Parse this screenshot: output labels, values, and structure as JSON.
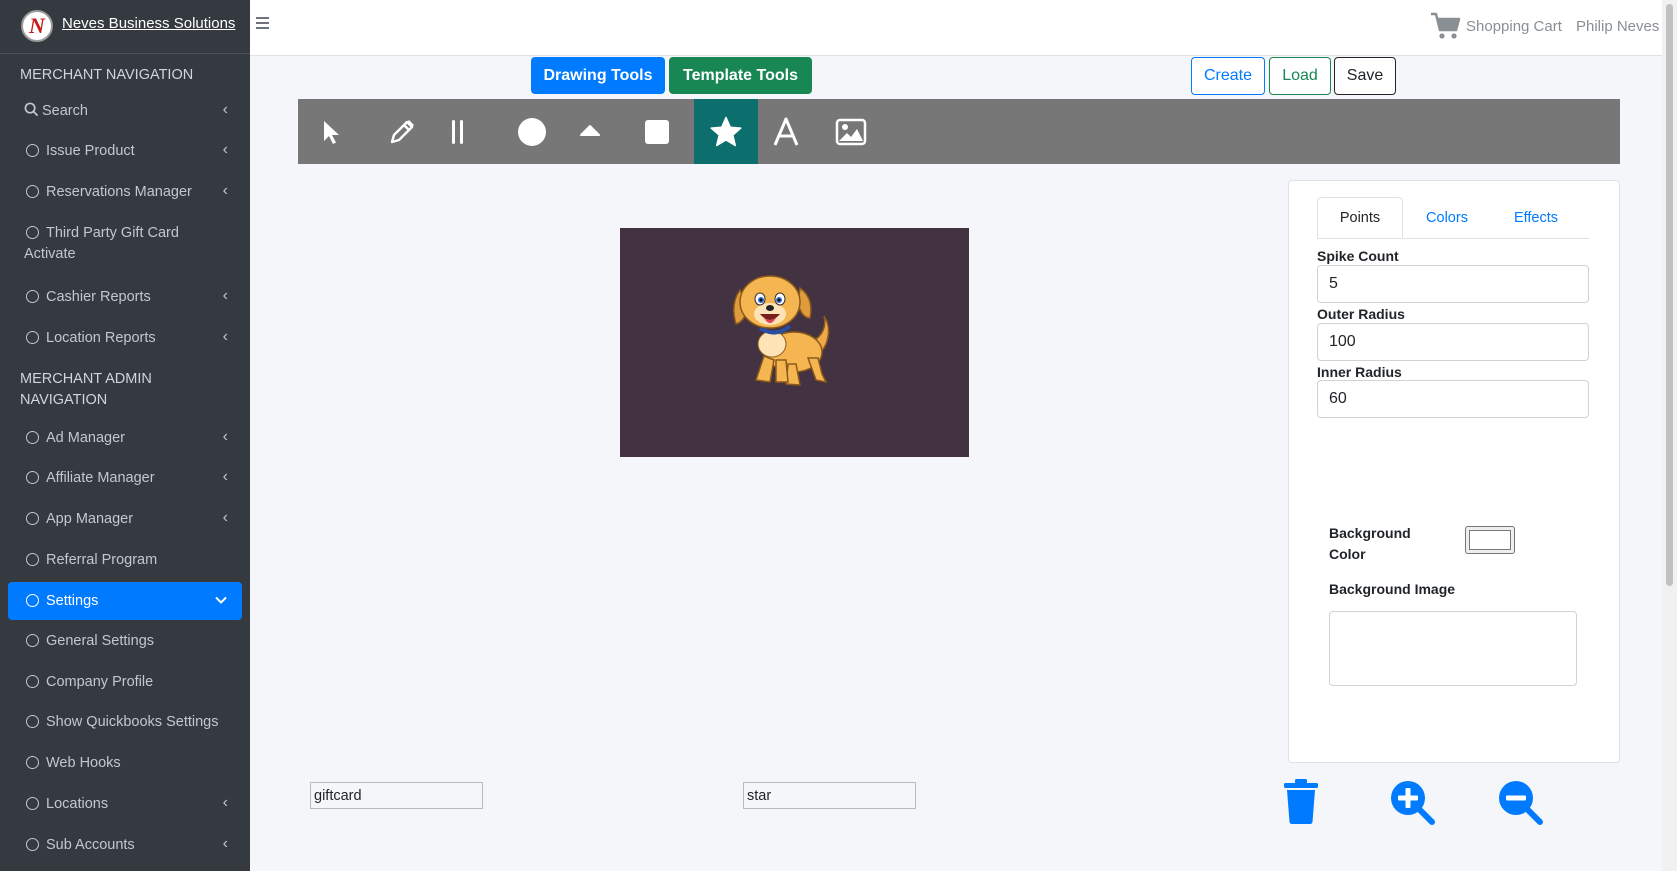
{
  "brand": {
    "logo_letter": "N",
    "name": "Neves Business Solutions"
  },
  "sidebar": {
    "header1": "MERCHANT NAVIGATION",
    "header2": "MERCHANT ADMIN NAVIGATION",
    "items": [
      {
        "label": "Search"
      },
      {
        "label": "Issue Product"
      },
      {
        "label": "Reservations Manager"
      },
      {
        "label": "Third Party Gift Card Activate"
      },
      {
        "label": "Cashier Reports"
      },
      {
        "label": "Location Reports"
      },
      {
        "label": "Ad Manager"
      },
      {
        "label": "Affiliate Manager"
      },
      {
        "label": "App Manager"
      },
      {
        "label": "Referral Program"
      },
      {
        "label": "Settings"
      },
      {
        "label": "General Settings"
      },
      {
        "label": "Company Profile"
      },
      {
        "label": "Show Quickbooks Settings"
      },
      {
        "label": "Web Hooks"
      },
      {
        "label": "Locations"
      },
      {
        "label": "Sub Accounts"
      }
    ]
  },
  "topbar": {
    "cart_label": "Shopping Cart",
    "user_name": "Philip Neves"
  },
  "editor": {
    "drawing_tools_label": "Drawing Tools",
    "template_tools_label": "Template Tools",
    "create_label": "Create",
    "load_label": "Load",
    "save_label": "Save",
    "tools": [
      "select-arrow-icon",
      "pencil-icon",
      "line-icon",
      "circle-icon",
      "triangle-icon",
      "rectangle-icon",
      "star-icon",
      "text-icon",
      "image-icon"
    ],
    "active_tool": "star-icon",
    "canvas_bg": "#433241",
    "template_name": "giftcard",
    "shape_name": "star"
  },
  "props": {
    "tabs": [
      "Points",
      "Colors",
      "Effects"
    ],
    "active_tab": "Points",
    "spike_count_label": "Spike Count",
    "spike_count": "5",
    "outer_radius_label": "Outer Radius",
    "outer_radius": "100",
    "inner_radius_label": "Inner Radius",
    "inner_radius": "60",
    "bg_color_label": "Background Color",
    "bg_image_label": "Background Image"
  },
  "colors": {
    "primary": "#007bff",
    "success": "#198754",
    "active_tool": "#0d6e6e",
    "sidebar_bg": "#343a40"
  }
}
